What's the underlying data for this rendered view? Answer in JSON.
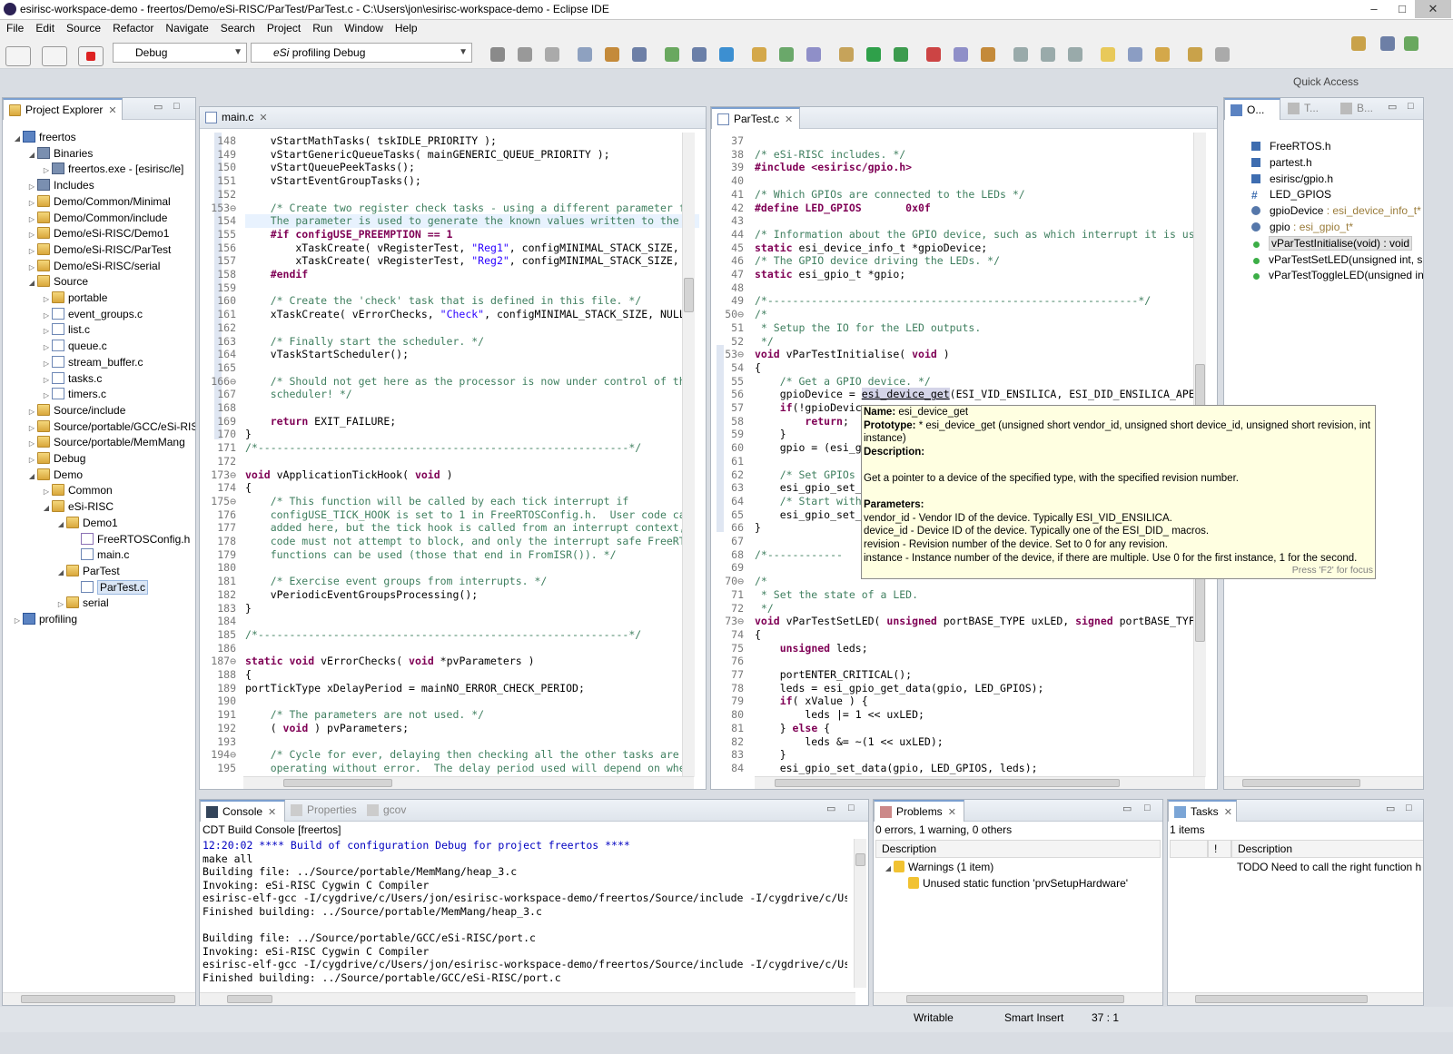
{
  "window": {
    "title": "esirisc-workspace-demo - freertos/Demo/eSi-RISC/ParTest/ParTest.c - C:\\Users\\jon\\esirisc-workspace-demo - Eclipse IDE",
    "min": "–",
    "max": "□",
    "close": "✕"
  },
  "menu": [
    "File",
    "Edit",
    "Source",
    "Refactor",
    "Navigate",
    "Search",
    "Project",
    "Run",
    "Window",
    "Help"
  ],
  "toolbar": {
    "build_config": "Debug",
    "launch_config_prefix": "eSi",
    "launch_config": "profiling Debug",
    "quick_access": "Quick Access"
  },
  "project_explorer": {
    "title": "Project Explorer",
    "tree": [
      {
        "label": "freertos",
        "depth": 0,
        "twisty": "◢",
        "icon": "proj"
      },
      {
        "label": "Binaries",
        "depth": 1,
        "twisty": "◢",
        "icon": "bin"
      },
      {
        "label": "freertos.exe - [esirisc/le]",
        "depth": 2,
        "twisty": "▷",
        "icon": "bin"
      },
      {
        "label": "Includes",
        "depth": 1,
        "twisty": "▷",
        "icon": "bin"
      },
      {
        "label": "Demo/Common/Minimal",
        "depth": 1,
        "twisty": "▷",
        "icon": "fold"
      },
      {
        "label": "Demo/Common/include",
        "depth": 1,
        "twisty": "▷",
        "icon": "fold"
      },
      {
        "label": "Demo/eSi-RISC/Demo1",
        "depth": 1,
        "twisty": "▷",
        "icon": "fold"
      },
      {
        "label": "Demo/eSi-RISC/ParTest",
        "depth": 1,
        "twisty": "▷",
        "icon": "fold"
      },
      {
        "label": "Demo/eSi-RISC/serial",
        "depth": 1,
        "twisty": "▷",
        "icon": "fold"
      },
      {
        "label": "Source",
        "depth": 1,
        "twisty": "◢",
        "icon": "fold"
      },
      {
        "label": "portable",
        "depth": 2,
        "twisty": "▷",
        "icon": "fold"
      },
      {
        "label": "event_groups.c",
        "depth": 2,
        "twisty": "▷",
        "icon": "cfile"
      },
      {
        "label": "list.c",
        "depth": 2,
        "twisty": "▷",
        "icon": "cfile"
      },
      {
        "label": "queue.c",
        "depth": 2,
        "twisty": "▷",
        "icon": "cfile"
      },
      {
        "label": "stream_buffer.c",
        "depth": 2,
        "twisty": "▷",
        "icon": "cfile"
      },
      {
        "label": "tasks.c",
        "depth": 2,
        "twisty": "▷",
        "icon": "cfile"
      },
      {
        "label": "timers.c",
        "depth": 2,
        "twisty": "▷",
        "icon": "cfile"
      },
      {
        "label": "Source/include",
        "depth": 1,
        "twisty": "▷",
        "icon": "fold"
      },
      {
        "label": "Source/portable/GCC/eSi-RISC",
        "depth": 1,
        "twisty": "▷",
        "icon": "fold"
      },
      {
        "label": "Source/portable/MemMang",
        "depth": 1,
        "twisty": "▷",
        "icon": "fold"
      },
      {
        "label": "Debug",
        "depth": 1,
        "twisty": "▷",
        "icon": "fold"
      },
      {
        "label": "Demo",
        "depth": 1,
        "twisty": "◢",
        "icon": "fold"
      },
      {
        "label": "Common",
        "depth": 2,
        "twisty": "▷",
        "icon": "fold"
      },
      {
        "label": "eSi-RISC",
        "depth": 2,
        "twisty": "◢",
        "icon": "fold"
      },
      {
        "label": "Demo1",
        "depth": 3,
        "twisty": "◢",
        "icon": "fold"
      },
      {
        "label": "FreeRTOSConfig.h",
        "depth": 4,
        "twisty": "",
        "icon": "hfile"
      },
      {
        "label": "main.c",
        "depth": 4,
        "twisty": "",
        "icon": "cfile"
      },
      {
        "label": "ParTest",
        "depth": 3,
        "twisty": "◢",
        "icon": "fold"
      },
      {
        "label": "ParTest.c",
        "depth": 4,
        "twisty": "",
        "icon": "cfile",
        "selected": true
      },
      {
        "label": "serial",
        "depth": 3,
        "twisty": "▷",
        "icon": "fold"
      },
      {
        "label": "profiling",
        "depth": 0,
        "twisty": "▷",
        "icon": "proj"
      }
    ]
  },
  "editor_main": {
    "tab": "main.c",
    "lines": [
      {
        "n": "148",
        "t": "    vStartMathTasks( tskIDLE_PRIORITY );"
      },
      {
        "n": "149",
        "t": "    vStartGenericQueueTasks( mainGENERIC_QUEUE_PRIORITY );"
      },
      {
        "n": "150",
        "t": "    vStartQueuePeekTasks();"
      },
      {
        "n": "151",
        "t": "    vStartEventGroupTasks();"
      },
      {
        "n": "152",
        "t": ""
      },
      {
        "n": "153⊖",
        "t": "    /* Create two register check tasks - using a different parameter f",
        "c": "cm"
      },
      {
        "n": "154",
        "t": "    The parameter is used to generate the known values written to the",
        "c": "cm",
        "hl": true
      },
      {
        "n": "155",
        "t": "    #if configUSE_PREEMPTION == 1",
        "c": "pp"
      },
      {
        "n": "156",
        "t": "        xTaskCreate( vRegisterTest, \"Reg1\", configMINIMAL_STACK_SIZE,"
      },
      {
        "n": "157",
        "t": "        xTaskCreate( vRegisterTest, \"Reg2\", configMINIMAL_STACK_SIZE,"
      },
      {
        "n": "158",
        "t": "    #endif",
        "c": "pp"
      },
      {
        "n": "159",
        "t": ""
      },
      {
        "n": "160",
        "t": "    /* Create the 'check' task that is defined in this file. */",
        "c": "cm"
      },
      {
        "n": "161",
        "t": "    xTaskCreate( vErrorChecks, \"Check\", configMINIMAL_STACK_SIZE, NULL"
      },
      {
        "n": "162",
        "t": ""
      },
      {
        "n": "163",
        "t": "    /* Finally start the scheduler. */",
        "c": "cm"
      },
      {
        "n": "164",
        "t": "    vTaskStartScheduler();"
      },
      {
        "n": "165",
        "t": ""
      },
      {
        "n": "166⊖",
        "t": "    /* Should not get here as the processor is now under control of th",
        "c": "cm"
      },
      {
        "n": "167",
        "t": "    scheduler! */",
        "c": "cm"
      },
      {
        "n": "168",
        "t": ""
      },
      {
        "n": "169",
        "t": "    return EXIT_FAILURE;"
      },
      {
        "n": "170",
        "t": "}"
      },
      {
        "n": "171",
        "t": "/*-----------------------------------------------------------*/",
        "c": "cm"
      },
      {
        "n": "172",
        "t": ""
      },
      {
        "n": "173⊖",
        "t": "void vApplicationTickHook( void )"
      },
      {
        "n": "174",
        "t": "{"
      },
      {
        "n": "175⊖",
        "t": "    /* This function will be called by each tick interrupt if",
        "c": "cm"
      },
      {
        "n": "176",
        "t": "    configUSE_TICK_HOOK is set to 1 in FreeRTOSConfig.h.  User code ca",
        "c": "cm"
      },
      {
        "n": "177",
        "t": "    added here, but the tick hook is called from an interrupt context,",
        "c": "cm"
      },
      {
        "n": "178",
        "t": "    code must not attempt to block, and only the interrupt safe FreeRT",
        "c": "cm"
      },
      {
        "n": "179",
        "t": "    functions can be used (those that end in FromISR()). */",
        "c": "cm"
      },
      {
        "n": "180",
        "t": ""
      },
      {
        "n": "181",
        "t": "    /* Exercise event groups from interrupts. */",
        "c": "cm"
      },
      {
        "n": "182",
        "t": "    vPeriodicEventGroupsProcessing();"
      },
      {
        "n": "183",
        "t": "}"
      },
      {
        "n": "184",
        "t": ""
      },
      {
        "n": "185",
        "t": "/*-----------------------------------------------------------*/",
        "c": "cm"
      },
      {
        "n": "186",
        "t": ""
      },
      {
        "n": "187⊖",
        "t": "static void vErrorChecks( void *pvParameters )"
      },
      {
        "n": "188",
        "t": "{"
      },
      {
        "n": "189",
        "t": "portTickType xDelayPeriod = mainNO_ERROR_CHECK_PERIOD;"
      },
      {
        "n": "190",
        "t": ""
      },
      {
        "n": "191",
        "t": "    /* The parameters are not used. */",
        "c": "cm"
      },
      {
        "n": "192",
        "t": "    ( void ) pvParameters;"
      },
      {
        "n": "193",
        "t": ""
      },
      {
        "n": "194⊖",
        "t": "    /* Cycle for ever, delaying then checking all the other tasks are",
        "c": "cm"
      },
      {
        "n": "195",
        "t": "    operating without error.  The delay period used will depend on whe",
        "c": "cm"
      }
    ]
  },
  "editor_partest": {
    "tab": "ParTest.c",
    "lines": [
      {
        "n": "37",
        "t": ""
      },
      {
        "n": "38",
        "t": "/* eSi-RISC includes. */",
        "c": "cm"
      },
      {
        "n": "39",
        "t": "#include <esirisc/gpio.h>",
        "c": "pp"
      },
      {
        "n": "40",
        "t": ""
      },
      {
        "n": "41",
        "t": "/* Which GPIOs are connected to the LEDs */",
        "c": "cm"
      },
      {
        "n": "42",
        "t": "#define LED_GPIOS       0x0f",
        "c": "pp"
      },
      {
        "n": "43",
        "t": ""
      },
      {
        "n": "44",
        "t": "/* Information about the GPIO device, such as which interrupt it is us",
        "c": "cm"
      },
      {
        "n": "45",
        "t": "static esi_device_info_t *gpioDevice;"
      },
      {
        "n": "46",
        "t": "/* The GPIO device driving the LEDs. */",
        "c": "cm"
      },
      {
        "n": "47",
        "t": "static esi_gpio_t *gpio;"
      },
      {
        "n": "48",
        "t": ""
      },
      {
        "n": "49",
        "t": "/*-----------------------------------------------------------*/",
        "c": "cm"
      },
      {
        "n": "50⊖",
        "t": "/*",
        "c": "cm"
      },
      {
        "n": "51",
        "t": " * Setup the IO for the LED outputs.",
        "c": "cm"
      },
      {
        "n": "52",
        "t": " */",
        "c": "cm"
      },
      {
        "n": "53⊖",
        "t": "void vParTestInitialise( void )"
      },
      {
        "n": "54",
        "t": "{"
      },
      {
        "n": "55",
        "t": "    /* Get a GPIO device. */",
        "c": "cm"
      },
      {
        "n": "56",
        "t": "    gpioDevice = esi_device_get(ESI_VID_ENSILICA, ESI_DID_ENSILICA_APE"
      },
      {
        "n": "57",
        "t": "    if(!gpioDevic"
      },
      {
        "n": "58",
        "t": "        return;"
      },
      {
        "n": "59",
        "t": "    }"
      },
      {
        "n": "60",
        "t": "    gpio = (esi_g"
      },
      {
        "n": "61",
        "t": ""
      },
      {
        "n": "62",
        "t": "    /* Set GPIOs",
        "c": "cm"
      },
      {
        "n": "63",
        "t": "    esi_gpio_set_"
      },
      {
        "n": "64",
        "t": "    /* Start with",
        "c": "cm"
      },
      {
        "n": "65",
        "t": "    esi_gpio_set_"
      },
      {
        "n": "66",
        "t": "}"
      },
      {
        "n": "67",
        "t": ""
      },
      {
        "n": "68",
        "t": "/*------------",
        "c": "cm"
      },
      {
        "n": "69",
        "t": ""
      },
      {
        "n": "70⊖",
        "t": "/*",
        "c": "cm"
      },
      {
        "n": "71",
        "t": " * Set the state of a LED.",
        "c": "cm"
      },
      {
        "n": "72",
        "t": " */",
        "c": "cm"
      },
      {
        "n": "73⊖",
        "t": "void vParTestSetLED( unsigned portBASE_TYPE uxLED, signed portBASE_TYF"
      },
      {
        "n": "74",
        "t": "{"
      },
      {
        "n": "75",
        "t": "    unsigned leds;"
      },
      {
        "n": "76",
        "t": ""
      },
      {
        "n": "77",
        "t": "    portENTER_CRITICAL();"
      },
      {
        "n": "78",
        "t": "    leds = esi_gpio_get_data(gpio, LED_GPIOS);"
      },
      {
        "n": "79",
        "t": "    if( xValue ) {"
      },
      {
        "n": "80",
        "t": "        leds |= 1 << uxLED;"
      },
      {
        "n": "81",
        "t": "    } else {"
      },
      {
        "n": "82",
        "t": "        leds &= ~(1 << uxLED);"
      },
      {
        "n": "83",
        "t": "    }"
      },
      {
        "n": "84",
        "t": "    esi_gpio_set_data(gpio, LED_GPIOS, leds);"
      }
    ]
  },
  "hover": {
    "name_label": "Name:",
    "name": " esi_device_get",
    "prototype_label": "Prototype:",
    "prototype": " * esi_device_get (unsigned short vendor_id, unsigned short device_id, unsigned short revision, int",
    "prototype_cont": " instance)",
    "description_label": "Description:",
    "description": "Get a pointer to a device of the specified type, with the specified revision number.",
    "parameters_label": "Parameters:",
    "params": [
      "vendor_id - Vendor ID of the device. Typically ESI_VID_ENSILICA.",
      "device_id - Device ID of the device. Typically one of the ESI_DID_ macros.",
      "revision - Revision number of the device. Set to 0 for any revision.",
      "instance - Instance number of the device, if there are multiple. Use 0 for the first instance, 1 for the second."
    ],
    "focus_hint": "Press 'F2' for focus"
  },
  "outline": {
    "tabs": [
      "O...",
      "T...",
      "B..."
    ],
    "items": [
      {
        "label": "FreeRTOS.h",
        "icon": "inc"
      },
      {
        "label": "partest.h",
        "icon": "inc"
      },
      {
        "label": "esirisc/gpio.h",
        "icon": "inc"
      },
      {
        "label": "LED_GPIOS",
        "icon": "def"
      },
      {
        "label": "gpioDevice",
        "type": " : esi_device_info_t*",
        "icon": "var"
      },
      {
        "label": "gpio",
        "type": " : esi_gpio_t*",
        "icon": "var"
      },
      {
        "label": "vParTestInitialise(void) : void",
        "icon": "fn",
        "selected": true
      },
      {
        "label": "vParTestSetLED(unsigned int, si",
        "icon": "fn"
      },
      {
        "label": "vParTestToggleLED(unsigned in",
        "icon": "fn"
      }
    ]
  },
  "console": {
    "tabs": [
      "Console",
      "Properties",
      "gcov"
    ],
    "header": "CDT Build Console [freertos]",
    "lines": [
      {
        "t": "12:20:02 **** Build of configuration Debug for project freertos ****",
        "blue": true
      },
      {
        "t": "make all"
      },
      {
        "t": "Building file: ../Source/portable/MemMang/heap_3.c"
      },
      {
        "t": "Invoking: eSi-RISC Cygwin C Compiler"
      },
      {
        "t": "esirisc-elf-gcc -I/cygdrive/c/Users/jon/esirisc-workspace-demo/freertos/Source/include -I/cygdrive/c/Use"
      },
      {
        "t": "Finished building: ../Source/portable/MemMang/heap_3.c"
      },
      {
        "t": ""
      },
      {
        "t": "Building file: ../Source/portable/GCC/eSi-RISC/port.c"
      },
      {
        "t": "Invoking: eSi-RISC Cygwin C Compiler"
      },
      {
        "t": "esirisc-elf-gcc -I/cygdrive/c/Users/jon/esirisc-workspace-demo/freertos/Source/include -I/cygdrive/c/Use"
      },
      {
        "t": "Finished building: ../Source/portable/GCC/eSi-RISC/port.c"
      }
    ]
  },
  "problems": {
    "tab": "Problems",
    "summary": "0 errors, 1 warning, 0 others",
    "col_description": "Description",
    "group": "Warnings (1 item)",
    "item": "Unused static function 'prvSetupHardware'"
  },
  "tasks": {
    "tab": "Tasks",
    "summary": "1 items",
    "col_priority": "!",
    "col_description": "Description",
    "item": "TODO Need to call the right function h"
  },
  "status": {
    "writable": "Writable",
    "insert_mode": "Smart Insert",
    "position": "37 : 1"
  }
}
